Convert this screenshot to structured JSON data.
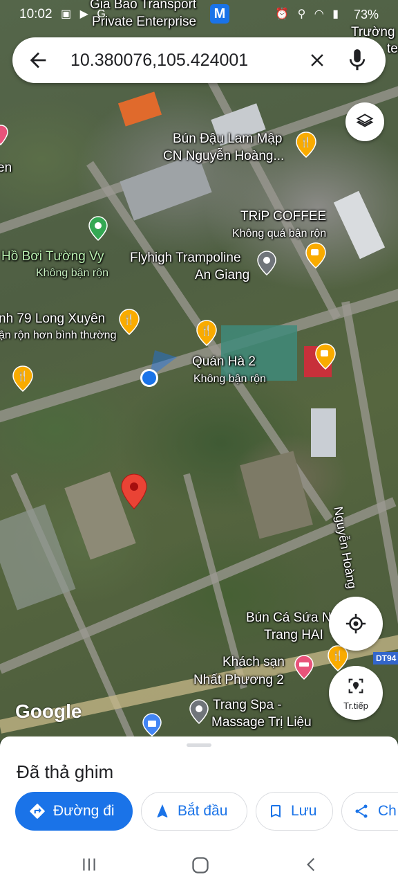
{
  "status_bar": {
    "time": "10:02",
    "battery": "73%",
    "left_icons": "▣ ▶ G",
    "right_icons": "⏰ ⚲ ◠ ▮"
  },
  "search": {
    "back_icon": "arrow-back-icon",
    "query": "10.380076,105.424001",
    "clear_icon": "close-icon",
    "mic_icon": "mic-icon"
  },
  "map_labels": {
    "gia_bao_1": "Gia Bao Transport",
    "gia_bao_2": "Private Enterprise",
    "truong": "Trường",
    "te": "te",
    "bun_dau_1": "Bún Đậu Lam Mập",
    "bun_dau_2": "CN Nguyễn Hoàng...",
    "en": "en",
    "trip_coffee": "TRiP COFFEE",
    "trip_status": "Không quá bận rộn",
    "ho_boi": "Hồ Bơi Tường Vy",
    "ho_boi_status": "Không bận rộn",
    "flyhigh_1": "Flyhigh Trampoline",
    "flyhigh_2": "An Giang",
    "nh79": "nh 79 Long Xuyên",
    "nh79_status": "ận rộn hơn bình thường",
    "quan_ha": "Quán Hà 2",
    "quan_ha_status": "Không bận rộn",
    "nguyen_hoang": "Nguyễn Hoàng",
    "bun_ca_1": "Bún Cá Sứa N",
    "bun_ca_2": "Trang HAI",
    "khach_san_1": "Khách sạn",
    "khach_san_2": "Nhất Phương 2",
    "trang_spa_1": "Trang Spa -",
    "trang_spa_2": "Massage Trị Liệu",
    "dt94": "DT94",
    "google": "Google"
  },
  "buttons": {
    "layers_icon": "layers-icon",
    "locate_icon": "my-location-icon",
    "navigate_icon": "navigate-icon",
    "navigate_label": "Tr.tiếp"
  },
  "sheet": {
    "title": "Đã thả ghim",
    "chips": [
      {
        "label": "Đường đi",
        "icon": "directions-icon"
      },
      {
        "label": "Bắt đầu",
        "icon": "navigation-arrow-icon"
      },
      {
        "label": "Lưu",
        "icon": "bookmark-icon"
      },
      {
        "label": "Ch",
        "icon": "share-icon"
      }
    ]
  },
  "colors": {
    "accent": "#1a73e8",
    "pin_red": "#ea4335",
    "food_pin": "#f9ab00",
    "location_dot": "#1a73e8"
  },
  "navbar": {
    "icons": [
      "recent-apps-icon",
      "home-icon",
      "back-icon"
    ]
  }
}
